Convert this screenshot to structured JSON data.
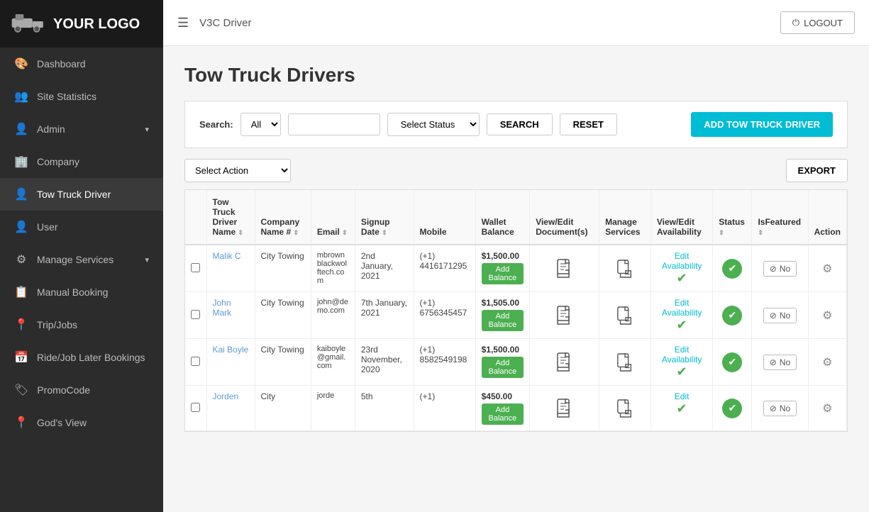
{
  "sidebar": {
    "logo_text": "YOUR\nLOGO",
    "items": [
      {
        "id": "dashboard",
        "label": "Dashboard",
        "icon": "🎨",
        "active": false
      },
      {
        "id": "site-statistics",
        "label": "Site Statistics",
        "icon": "👥",
        "active": false
      },
      {
        "id": "admin",
        "label": "Admin",
        "icon": "👤",
        "active": false,
        "has_chevron": true
      },
      {
        "id": "company",
        "label": "Company",
        "icon": "🏢",
        "active": false
      },
      {
        "id": "tow-truck-driver",
        "label": "Tow Truck Driver",
        "icon": "👤",
        "active": true
      },
      {
        "id": "user",
        "label": "User",
        "icon": "👤",
        "active": false
      },
      {
        "id": "manage-services",
        "label": "Manage Services",
        "icon": "⚙",
        "active": false,
        "has_chevron": true
      },
      {
        "id": "manual-booking",
        "label": "Manual Booking",
        "icon": "📋",
        "active": false
      },
      {
        "id": "trip-jobs",
        "label": "Trip/Jobs",
        "icon": "📍",
        "active": false
      },
      {
        "id": "ride-later",
        "label": "Ride/Job Later Bookings",
        "icon": "📅",
        "active": false
      },
      {
        "id": "promo-code",
        "label": "PromoCode",
        "icon": "🏷",
        "active": false
      },
      {
        "id": "gods-view",
        "label": "God's View",
        "icon": "📍",
        "active": false
      }
    ]
  },
  "topbar": {
    "menu_icon": "☰",
    "title": "V3C Driver",
    "logout_label": "LOGOUT"
  },
  "page": {
    "title": "Tow Truck Drivers"
  },
  "search": {
    "label": "Search:",
    "all_option": "All",
    "input_placeholder": "",
    "status_placeholder": "Select Status",
    "search_btn": "SEARCH",
    "reset_btn": "RESET",
    "add_btn": "ADD TOW TRUCK DRIVER"
  },
  "action_bar": {
    "select_action": "Select Action",
    "export_btn": "EXPORT"
  },
  "table": {
    "columns": [
      {
        "id": "checkbox",
        "label": ""
      },
      {
        "id": "name",
        "label": "Tow Truck Driver Name"
      },
      {
        "id": "company",
        "label": "Company Name #"
      },
      {
        "id": "email",
        "label": "Email"
      },
      {
        "id": "signup",
        "label": "Signup Date"
      },
      {
        "id": "mobile",
        "label": "Mobile"
      },
      {
        "id": "wallet",
        "label": "Wallet Balance"
      },
      {
        "id": "view-edit-doc",
        "label": "View/Edit Document(s)"
      },
      {
        "id": "manage-services",
        "label": "Manage Services"
      },
      {
        "id": "view-edit-avail",
        "label": "View/Edit Availability"
      },
      {
        "id": "status",
        "label": "Status"
      },
      {
        "id": "is-featured",
        "label": "IsFeatured"
      },
      {
        "id": "action",
        "label": "Action"
      }
    ],
    "rows": [
      {
        "id": 1,
        "name": "Malik C",
        "company": "City Towing",
        "email": "mbrownblackwolftech.com",
        "signup": "2nd January, 2021",
        "mobile": "(+1) 4416171295",
        "wallet": "$1,500.00",
        "edit_avail": "Edit Availability",
        "status": "active",
        "is_featured": "No"
      },
      {
        "id": 2,
        "name": "John Mark",
        "company": "City Towing",
        "email": "john@demo.com",
        "signup": "7th January, 2021",
        "mobile": "(+1) 6756345457",
        "wallet": "$1,505.00",
        "edit_avail": "Edit Availability",
        "status": "active",
        "is_featured": "No"
      },
      {
        "id": 3,
        "name": "Kai Boyle",
        "company": "City Towing",
        "email": "kaiboyle@gmail.com",
        "signup": "23rd November, 2020",
        "mobile": "(+1) 8582549198",
        "wallet": "$1,500.00",
        "edit_avail": "Edit Availability",
        "status": "active",
        "is_featured": "No"
      },
      {
        "id": 4,
        "name": "Jorden",
        "company": "City",
        "email": "jorde",
        "signup": "5th",
        "mobile": "(+1)",
        "wallet": "$450.00",
        "edit_avail": "Edit",
        "status": "active",
        "is_featured": "No"
      }
    ]
  }
}
